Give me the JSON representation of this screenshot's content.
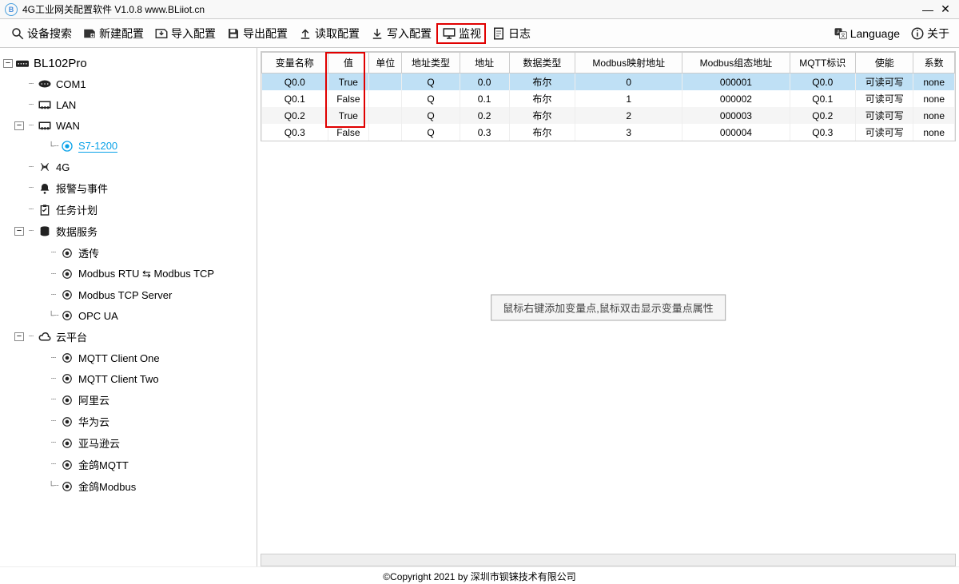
{
  "titlebar": {
    "title": "4G工业网关配置软件 V1.0.8 www.BLiiot.cn"
  },
  "toolbar": {
    "search": "设备搜索",
    "new": "新建配置",
    "import": "导入配置",
    "export": "导出配置",
    "read": "读取配置",
    "write": "写入配置",
    "monitor": "监视",
    "log": "日志",
    "language": "Language",
    "about": "关于"
  },
  "tree": {
    "root": "BL102Pro",
    "com1": "COM1",
    "lan": "LAN",
    "wan": "WAN",
    "s71200": "S7-1200",
    "g4": "4G",
    "alarm": "报警与事件",
    "task": "任务计划",
    "dataservice": "数据服务",
    "passthrough": "透传",
    "mbrtu": "Modbus RTU ⇆ Modbus TCP",
    "mbtcp": "Modbus TCP Server",
    "opcua": "OPC UA",
    "cloud": "云平台",
    "mqtt1": "MQTT Client One",
    "mqtt2": "MQTT Client Two",
    "ali": "阿里云",
    "huawei": "华为云",
    "aws": "亚马逊云",
    "kpmqtt": "金鸽MQTT",
    "kpmb": "金鸽Modbus"
  },
  "table": {
    "headers": [
      "变量名称",
      "值",
      "单位",
      "地址类型",
      "地址",
      "数据类型",
      "Modbus映射地址",
      "Modbus组态地址",
      "MQTT标识",
      "使能",
      "系数"
    ],
    "rows": [
      {
        "name": "Q0.0",
        "value": "True",
        "unit": "",
        "atype": "Q",
        "addr": "0.0",
        "dtype": "布尔",
        "map": "0",
        "cfg": "000001",
        "mqtt": "Q0.0",
        "en": "可读可写",
        "coef": "none"
      },
      {
        "name": "Q0.1",
        "value": "False",
        "unit": "",
        "atype": "Q",
        "addr": "0.1",
        "dtype": "布尔",
        "map": "1",
        "cfg": "000002",
        "mqtt": "Q0.1",
        "en": "可读可写",
        "coef": "none"
      },
      {
        "name": "Q0.2",
        "value": "True",
        "unit": "",
        "atype": "Q",
        "addr": "0.2",
        "dtype": "布尔",
        "map": "2",
        "cfg": "000003",
        "mqtt": "Q0.2",
        "en": "可读可写",
        "coef": "none"
      },
      {
        "name": "Q0.3",
        "value": "False",
        "unit": "",
        "atype": "Q",
        "addr": "0.3",
        "dtype": "布尔",
        "map": "3",
        "cfg": "000004",
        "mqtt": "Q0.3",
        "en": "可读可写",
        "coef": "none"
      }
    ]
  },
  "hint": "鼠标右键添加变量点,鼠标双击显示变量点属性",
  "footer": "©Copyright 2021 by 深圳市钡铼技术有限公司"
}
